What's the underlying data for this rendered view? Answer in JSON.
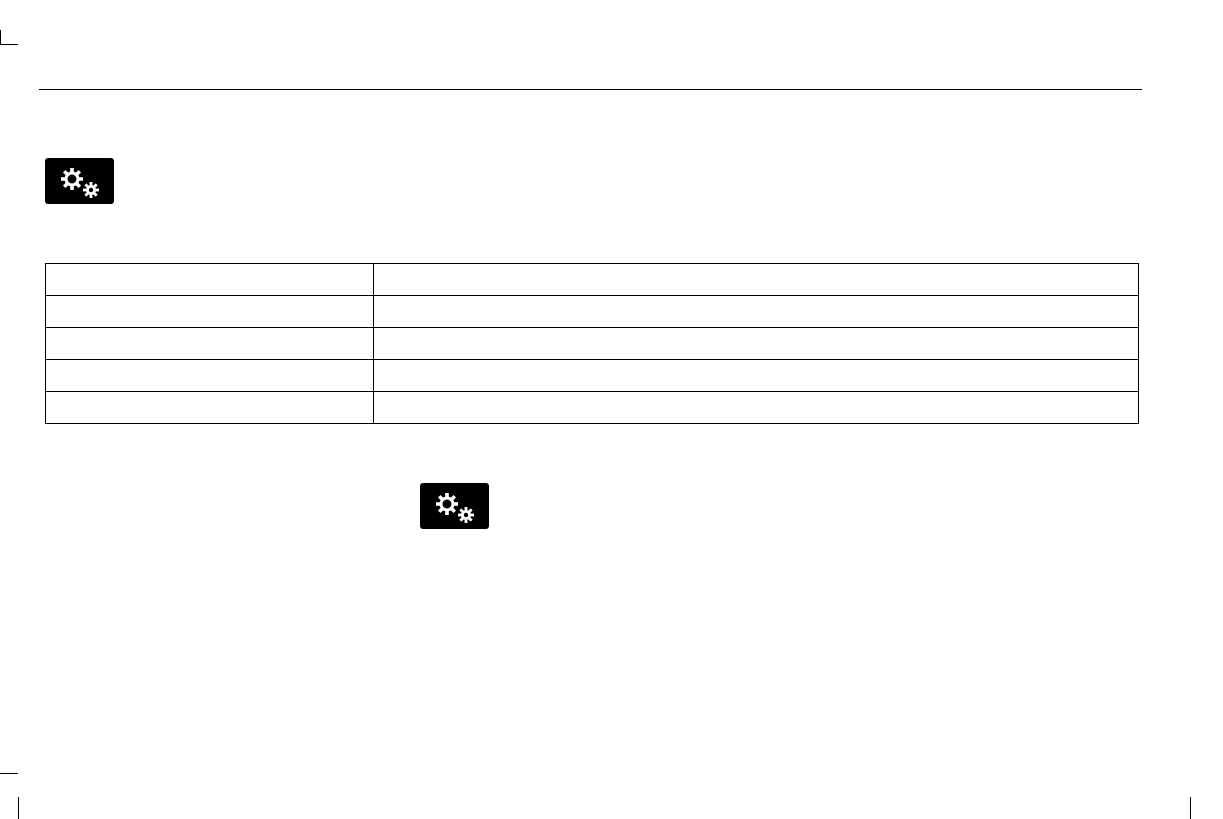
{
  "page": {
    "icons": [
      {
        "name": "settings-icon",
        "color": "#000000",
        "glyph_color": "#ffffff"
      },
      {
        "name": "settings-icon",
        "color": "#000000",
        "glyph_color": "#ffffff"
      }
    ]
  },
  "table": {
    "rows": [
      {
        "setting": "",
        "description": ""
      },
      {
        "setting": "",
        "description": ""
      },
      {
        "setting": "",
        "description": ""
      },
      {
        "setting": "",
        "description": ""
      },
      {
        "setting": "",
        "description": ""
      }
    ]
  }
}
